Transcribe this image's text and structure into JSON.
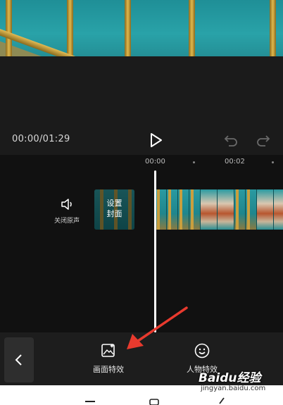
{
  "player": {
    "timecode": "00:00/01:29"
  },
  "timeline": {
    "ticks": [
      "00:00",
      "00:02"
    ],
    "mute_label": "关闭原声",
    "cover_label_line1": "设置",
    "cover_label_line2": "封面"
  },
  "toolbar": {
    "effects_label": "画面特效",
    "person_effects_label": "人物特效"
  },
  "watermark": {
    "logo": "Baidu经验",
    "url": "jingyan.baidu.com"
  },
  "colors": {
    "annotation_arrow": "#e83a2e",
    "playhead": "#ffffff",
    "background": "#111111"
  }
}
